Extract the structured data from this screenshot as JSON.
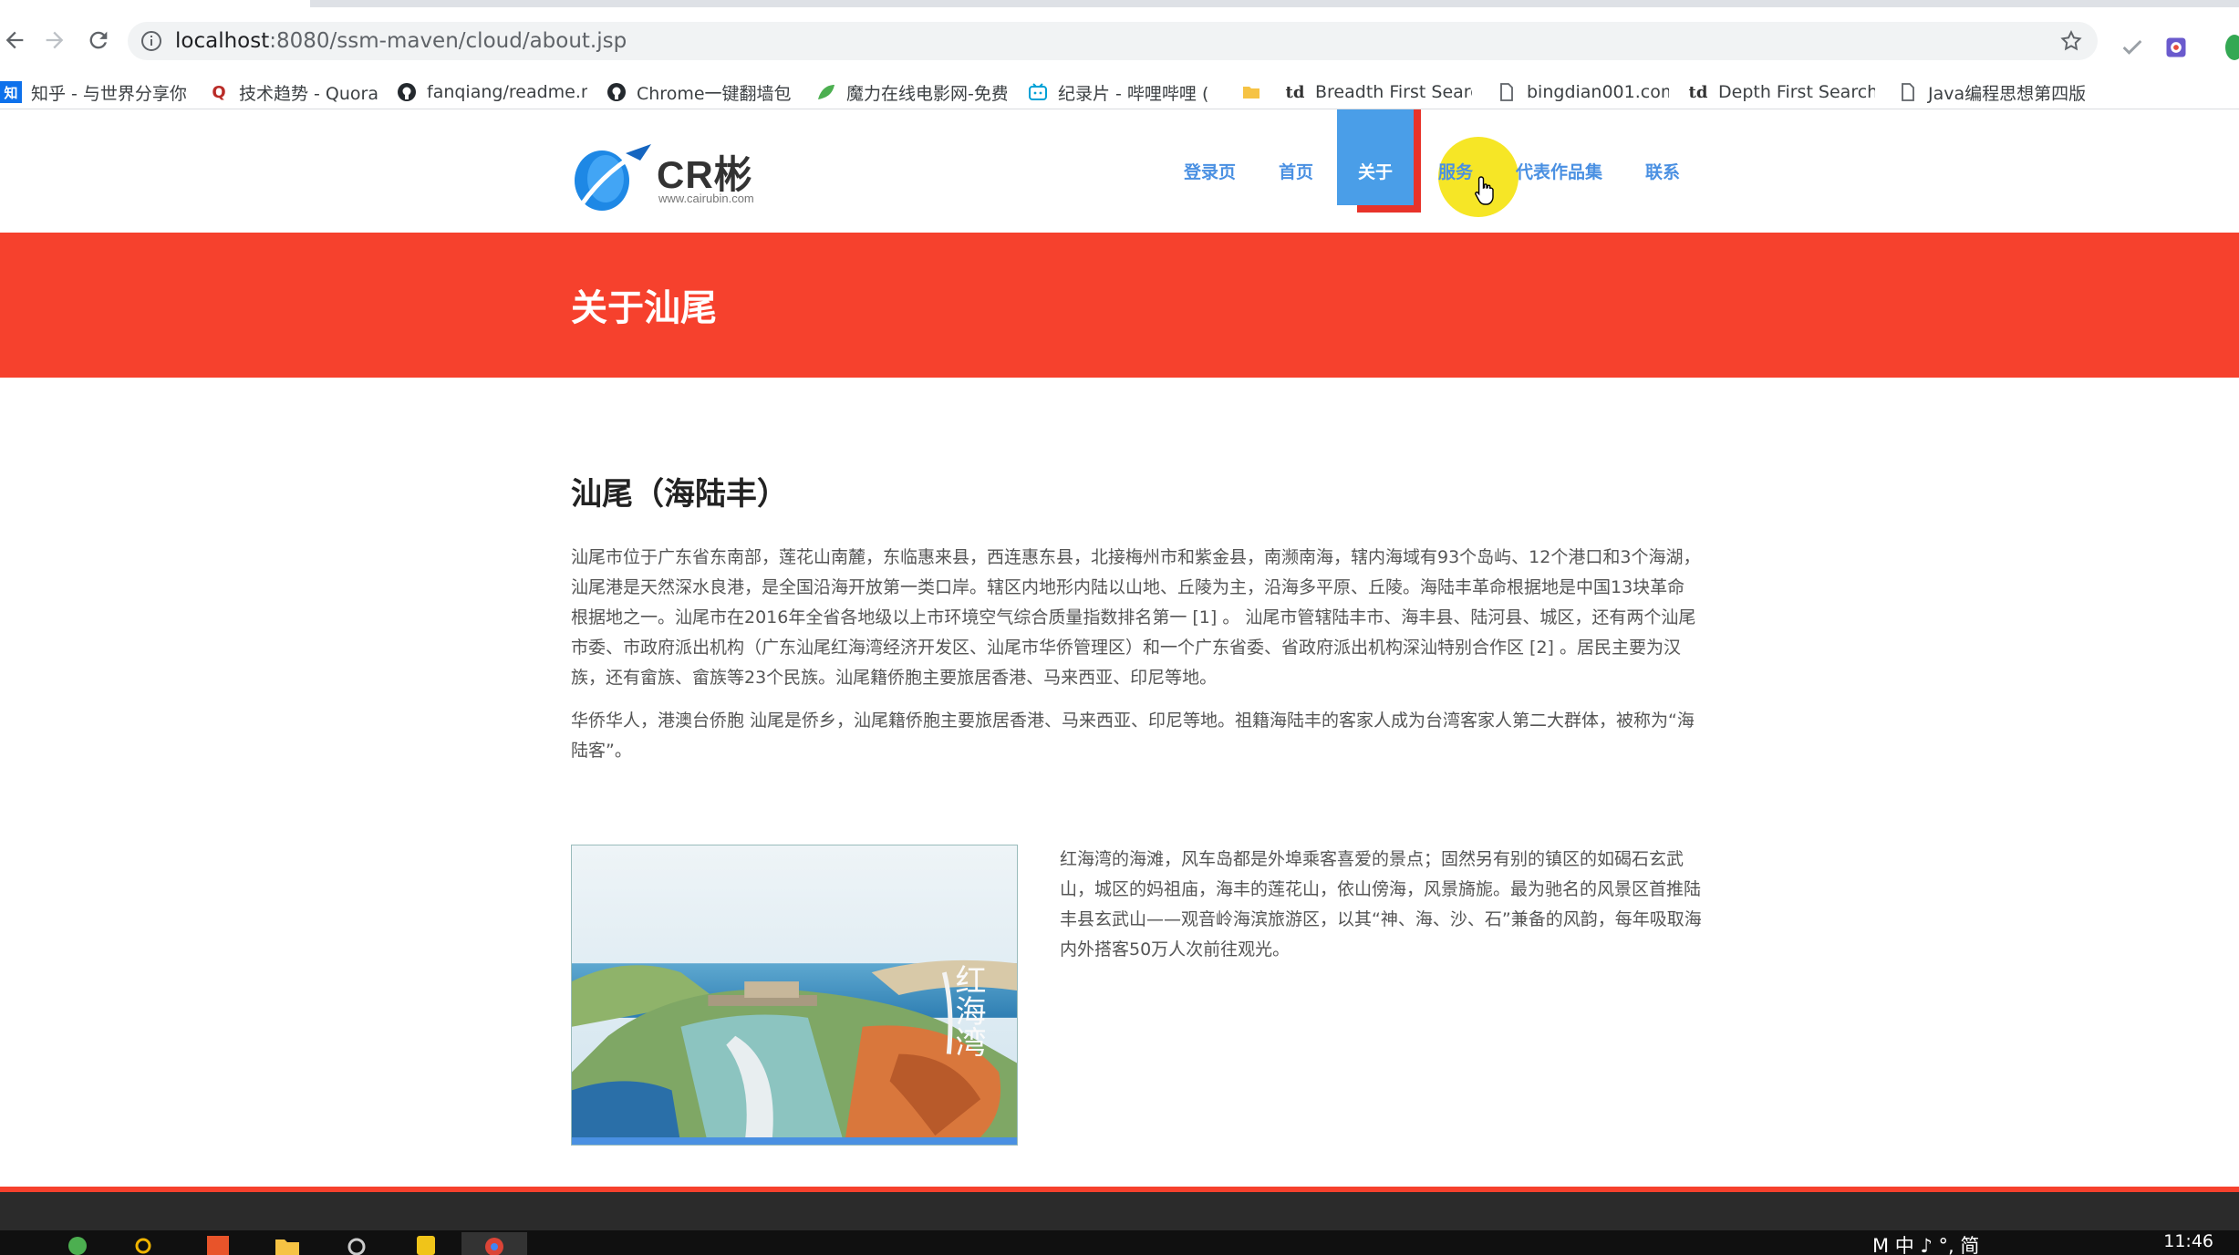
{
  "browser": {
    "url_host": "localhost",
    "url_path": ":8080/ssm-maven/cloud/about.jsp",
    "bookmarks": [
      {
        "label": "知乎 - 与世界分享你",
        "icon": "zhihu-icon"
      },
      {
        "label": "技术趋势 - Quora",
        "icon": "quora-icon"
      },
      {
        "label": "fanqiang/readme.m",
        "icon": "github-icon"
      },
      {
        "label": "Chrome一键翻墙包",
        "icon": "github-icon"
      },
      {
        "label": "魔力在线电影网-免费",
        "icon": "leaf-icon"
      },
      {
        "label": "纪录片 - 哔哩哔哩 (",
        "icon": "bilibili-icon"
      },
      {
        "label": "",
        "icon": "folder-icon"
      },
      {
        "label": "Breadth First Searc",
        "icon": "td-icon"
      },
      {
        "label": "bingdian001.com",
        "icon": "page-icon"
      },
      {
        "label": "Depth First Search (",
        "icon": "td-icon"
      },
      {
        "label": "Java编程思想第四版",
        "icon": "page-icon"
      }
    ]
  },
  "site": {
    "logo_name": "CR彬",
    "logo_sub": "www.cairubin.com",
    "menu": [
      "登录页",
      "首页",
      "关于",
      "服务",
      "代表作品集",
      "联系"
    ],
    "banner_title": "关于汕尾"
  },
  "content": {
    "heading": "汕尾（海陆丰）",
    "para1": "汕尾市位于广东省东南部，莲花山南麓，东临惠来县，西连惠东县，北接梅州市和紫金县，南濒南海，辖内海域有93个岛屿、12个港口和3个海湖，汕尾港是天然深水良港，是全国沿海开放第一类口岸。辖区内地形内陆以山地、丘陵为主，沿海多平原、丘陵。海陆丰革命根据地是中国13块革命根据地之一。汕尾市在2016年全省各地级以上市环境空气综合质量指数排名第一 [1] 。 汕尾市管辖陆丰市、海丰县、陆河县、城区，还有两个汕尾市委、市政府派出机构（广东汕尾红海湾经济开发区、汕尾市华侨管理区）和一个广东省委、省政府派出机构深汕特别合作区 [2] 。居民主要为汉族，还有畲族、畲族等23个民族。汕尾籍侨胞主要旅居香港、马来西亚、印尼等地。",
    "para2": "华侨华人，港澳台侨胞 汕尾是侨乡，汕尾籍侨胞主要旅居香港、马来西亚、印尼等地。祖籍海陆丰的客家人成为台湾客家人第二大群体，被称为“海陆客”。",
    "media_text": "红海湾的海滩，风车岛都是外埠乘客喜爱的景点；固然另有别的镇区的如碣石玄武山，城区的妈祖庙，海丰的莲花山，依山傍海，风景旖旎。最为驰名的风景区首推陆丰县玄武山——观音岭海滨旅游区，以其“神、海、沙、石”兼备的风韵，每年吸取海内外搭客50万人次前往观光。",
    "photo_watermark": "红海湾"
  },
  "taskbar": {
    "ime": "M 中 ♪ °, 简",
    "clock": "11:46"
  },
  "colors": {
    "accent_red": "#f6412d",
    "menu_blue": "#4a90e2",
    "active_blue": "#4a9ee8",
    "cursor_yellow": "#f6e51a"
  }
}
